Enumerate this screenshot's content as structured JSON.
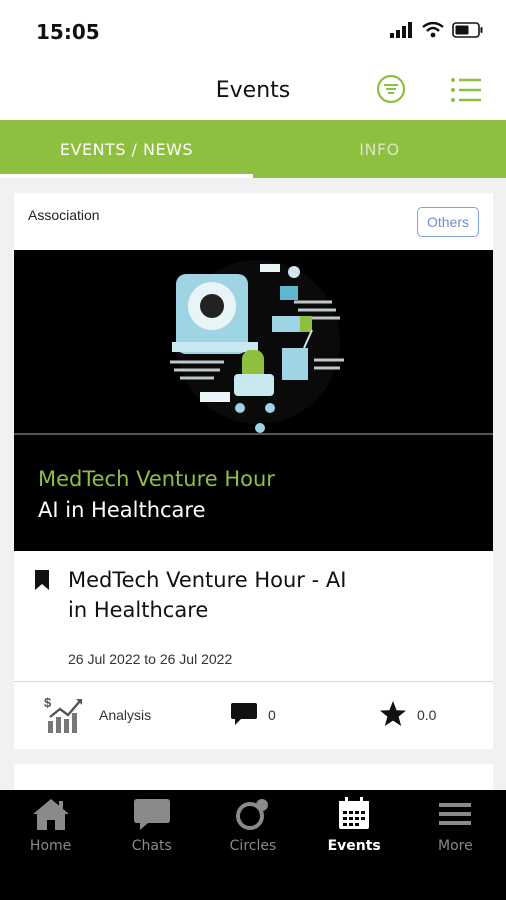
{
  "status_bar": {
    "time": "15:05"
  },
  "header": {
    "title": "Events"
  },
  "tabs": [
    {
      "label": "EVENTS / NEWS",
      "active": true
    },
    {
      "label": "INFO",
      "active": false
    }
  ],
  "event": {
    "organization": "Association",
    "badge": "Others",
    "banner_title": "MedTech Venture Hour",
    "banner_subtitle": "AI in Healthcare",
    "title": "MedTech Venture Hour - AI in Healthcare",
    "date_range": "26 Jul 2022 to 26 Jul 2022",
    "analysis_label": "Analysis",
    "comment_count": "0",
    "rating": "0.0"
  },
  "bottom_nav": [
    {
      "label": "Home",
      "icon": "home-icon",
      "active": false
    },
    {
      "label": "Chats",
      "icon": "chat-icon",
      "active": false
    },
    {
      "label": "Circles",
      "icon": "circles-icon",
      "active": false
    },
    {
      "label": "Events",
      "icon": "calendar-icon",
      "active": true
    },
    {
      "label": "More",
      "icon": "menu-icon",
      "active": false
    }
  ],
  "colors": {
    "accent": "#8fbf3f",
    "badge": "#6b8fcf"
  }
}
